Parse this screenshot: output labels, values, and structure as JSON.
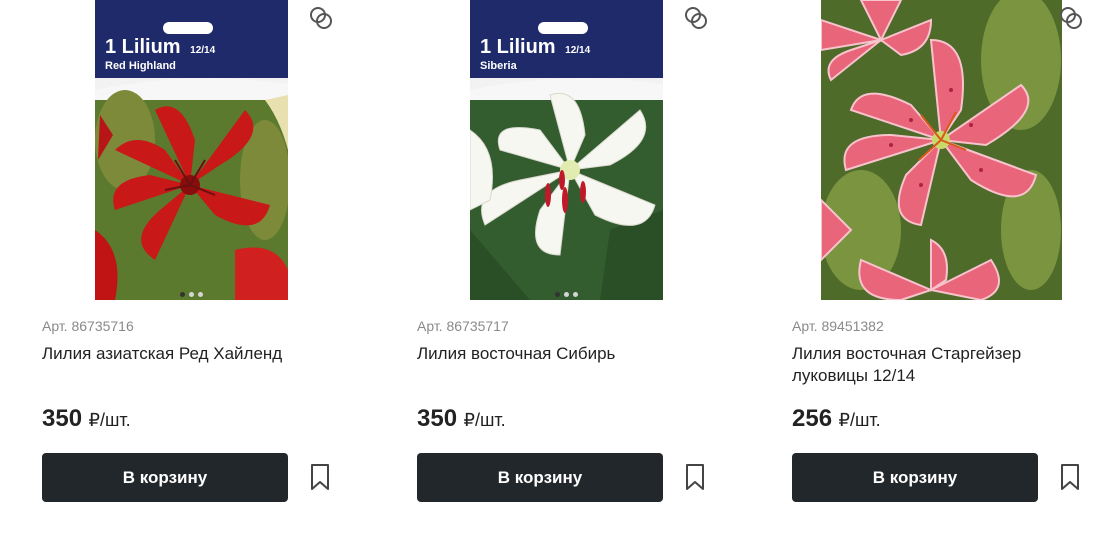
{
  "products": [
    {
      "image": {
        "package_brand": "1 Lilium",
        "package_size": "12/14",
        "package_variety": "Red Highland",
        "dots": 3,
        "active_dot": 0
      },
      "sku": "Арт. 86735716",
      "title": "Лилия азиатская Ред Хайленд",
      "price": "350",
      "unit": "₽/шт.",
      "cart_label": "В корзину",
      "compare_icon": "compare-icon",
      "favorite_icon": "bookmark-icon"
    },
    {
      "image": {
        "package_brand": "1 Lilium",
        "package_size": "12/14",
        "package_variety": "Siberia",
        "dots": 3,
        "active_dot": 0
      },
      "sku": "Арт. 86735717",
      "title": "Лилия восточная Сибирь",
      "price": "350",
      "unit": "₽/шт.",
      "cart_label": "В корзину",
      "compare_icon": "compare-icon",
      "favorite_icon": "bookmark-icon"
    },
    {
      "image": {
        "dots": 0
      },
      "sku": "Арт. 89451382",
      "title": "Лилия восточная Старгейзер луковицы 12/14",
      "price": "256",
      "unit": "₽/шт.",
      "cart_label": "В корзину",
      "compare_icon": "compare-icon",
      "favorite_icon": "bookmark-icon"
    }
  ],
  "colors": {
    "button_bg": "#22272b",
    "package_blue": "#1f2a6b",
    "red_lily": "#d11a1a",
    "white_lily": "#f6f6f2",
    "pink_lily": "#e8657a"
  }
}
